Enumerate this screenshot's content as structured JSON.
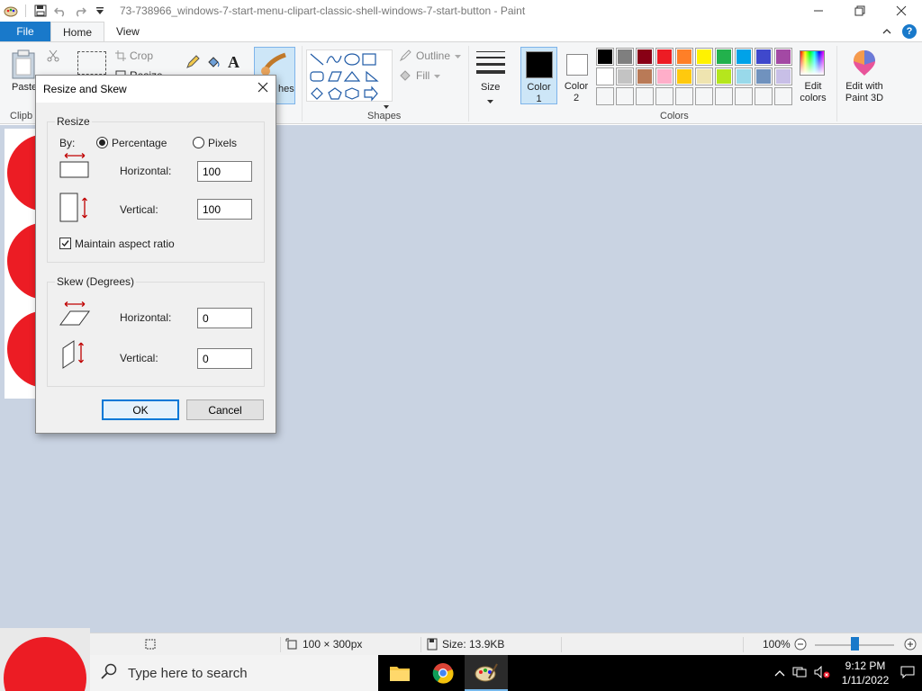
{
  "window": {
    "title": "73-738966_windows-7-start-menu-clipart-classic-shell-windows-7-start-button - Paint"
  },
  "tabs": {
    "file": "File",
    "home": "Home",
    "view": "View"
  },
  "ribbon": {
    "clipboard": {
      "paste": "Paste",
      "group": "Clipb"
    },
    "image": {
      "crop": "Crop",
      "resize_partial": "Resize"
    },
    "brushes_partial": "hes",
    "shapes": {
      "outline": "Outline",
      "fill": "Fill",
      "group": "Shapes"
    },
    "size": "Size",
    "color1": {
      "line1": "Color",
      "line2": "1",
      "value": "#000000"
    },
    "color2": {
      "line1": "Color",
      "line2": "2",
      "value": "#ffffff"
    },
    "edit_colors": {
      "line1": "Edit",
      "line2": "colors"
    },
    "paint3d": {
      "line1": "Edit with",
      "line2": "Paint 3D"
    },
    "colors_group": "Colors",
    "palette_row1": [
      "#000000",
      "#7f7f7f",
      "#880015",
      "#ed1c24",
      "#ff7f27",
      "#fff200",
      "#22b14c",
      "#00a2e8",
      "#3f48cc",
      "#a349a4"
    ],
    "palette_row2": [
      "#ffffff",
      "#c3c3c3",
      "#b97a57",
      "#ffaec9",
      "#ffc90e",
      "#efe4b0",
      "#b5e61d",
      "#99d9ea",
      "#7092be",
      "#c8bfe7"
    ]
  },
  "dialog": {
    "title": "Resize and Skew",
    "resize": {
      "legend": "Resize",
      "by_label": "By:",
      "percentage": "Percentage",
      "pixels": "Pixels",
      "horizontal_label": "Horizontal:",
      "horizontal_value": "100",
      "vertical_label": "Vertical:",
      "vertical_value": "100",
      "maintain": "Maintain aspect ratio"
    },
    "skew": {
      "legend": "Skew (Degrees)",
      "horizontal_label": "Horizontal:",
      "horizontal_value": "0",
      "vertical_label": "Vertical:",
      "vertical_value": "0"
    },
    "ok": "OK",
    "cancel": "Cancel"
  },
  "status": {
    "dimensions": "100 × 300px",
    "size": "Size: 13.9KB",
    "zoom": "100%",
    "zoom_fraction": 0.5
  },
  "taskbar": {
    "search_placeholder": "Type here to search",
    "time": "9:12 PM",
    "date": "1/11/2022"
  }
}
